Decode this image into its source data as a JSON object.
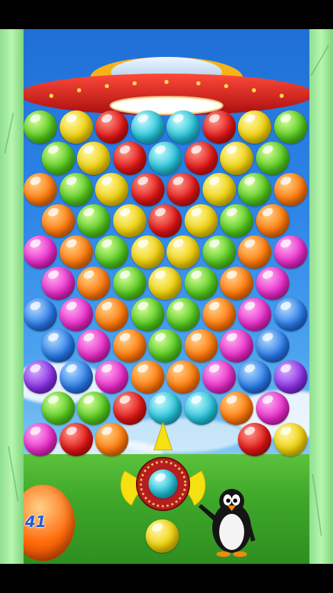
{
  "game": {
    "score_ball_text": "41",
    "colors": {
      "green": "#55c91e",
      "yellow": "#f0d10a",
      "red": "#e01515",
      "cyan": "#27c3d9",
      "orange": "#ff7a0a",
      "magenta": "#e82cc8",
      "blue": "#2a7be8",
      "purple": "#8c32e6"
    },
    "bubble_rows": [
      [
        "green",
        "yellow",
        "red",
        "cyan",
        "cyan",
        "red",
        "yellow",
        "green"
      ],
      [
        "green",
        "yellow",
        "red",
        "cyan",
        "red",
        "yellow",
        "green"
      ],
      [
        "orange",
        "green",
        "yellow",
        "red",
        "red",
        "yellow",
        "green",
        "orange"
      ],
      [
        "orange",
        "green",
        "yellow",
        "red",
        "yellow",
        "green",
        "orange"
      ],
      [
        "magenta",
        "orange",
        "green",
        "yellow",
        "yellow",
        "green",
        "orange",
        "magenta"
      ],
      [
        "magenta",
        "orange",
        "green",
        "yellow",
        "green",
        "orange",
        "magenta"
      ],
      [
        "blue",
        "magenta",
        "orange",
        "green",
        "green",
        "orange",
        "magenta",
        "blue"
      ],
      [
        "blue",
        "magenta",
        "orange",
        "green",
        "orange",
        "magenta",
        "blue"
      ],
      [
        "purple",
        "blue",
        "magenta",
        "orange",
        "orange",
        "magenta",
        "blue",
        "purple"
      ],
      [
        "green",
        "green",
        "red",
        "cyan",
        "cyan",
        "orange",
        "magenta"
      ],
      [
        "magenta",
        "red",
        "orange",
        null,
        null,
        null,
        "red",
        "yellow"
      ]
    ],
    "current_bubble": "cyan",
    "next_bubble": "yellow"
  }
}
